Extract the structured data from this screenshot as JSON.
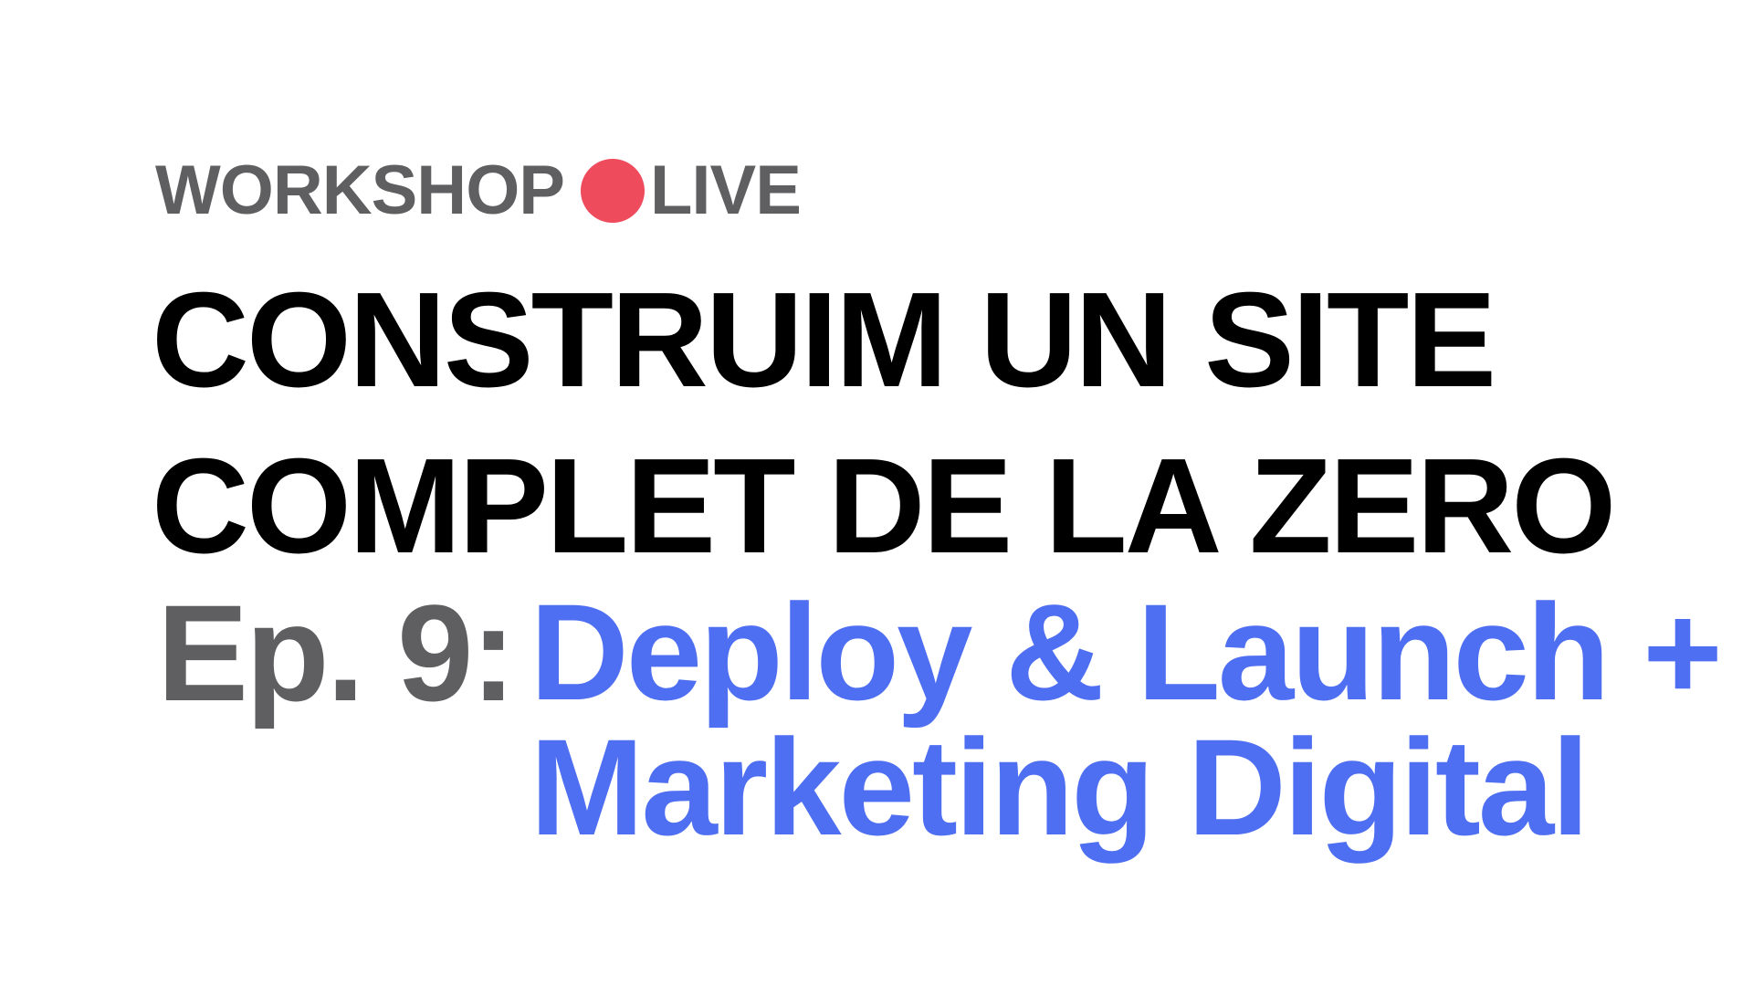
{
  "badge": {
    "workshop": "WORKSHOP",
    "live": "LIVE",
    "dot_color": "#ee4b5c"
  },
  "title": {
    "line1": "CONSTRUIM UN SITE",
    "line2": "COMPLET DE LA ZERO"
  },
  "episode": {
    "label": "Ep. 9:",
    "title_line1": "Deploy & Launch +",
    "title_line2": "Marketing Digital",
    "accent_color": "#4f6ff2",
    "label_color": "#5f5e60"
  }
}
